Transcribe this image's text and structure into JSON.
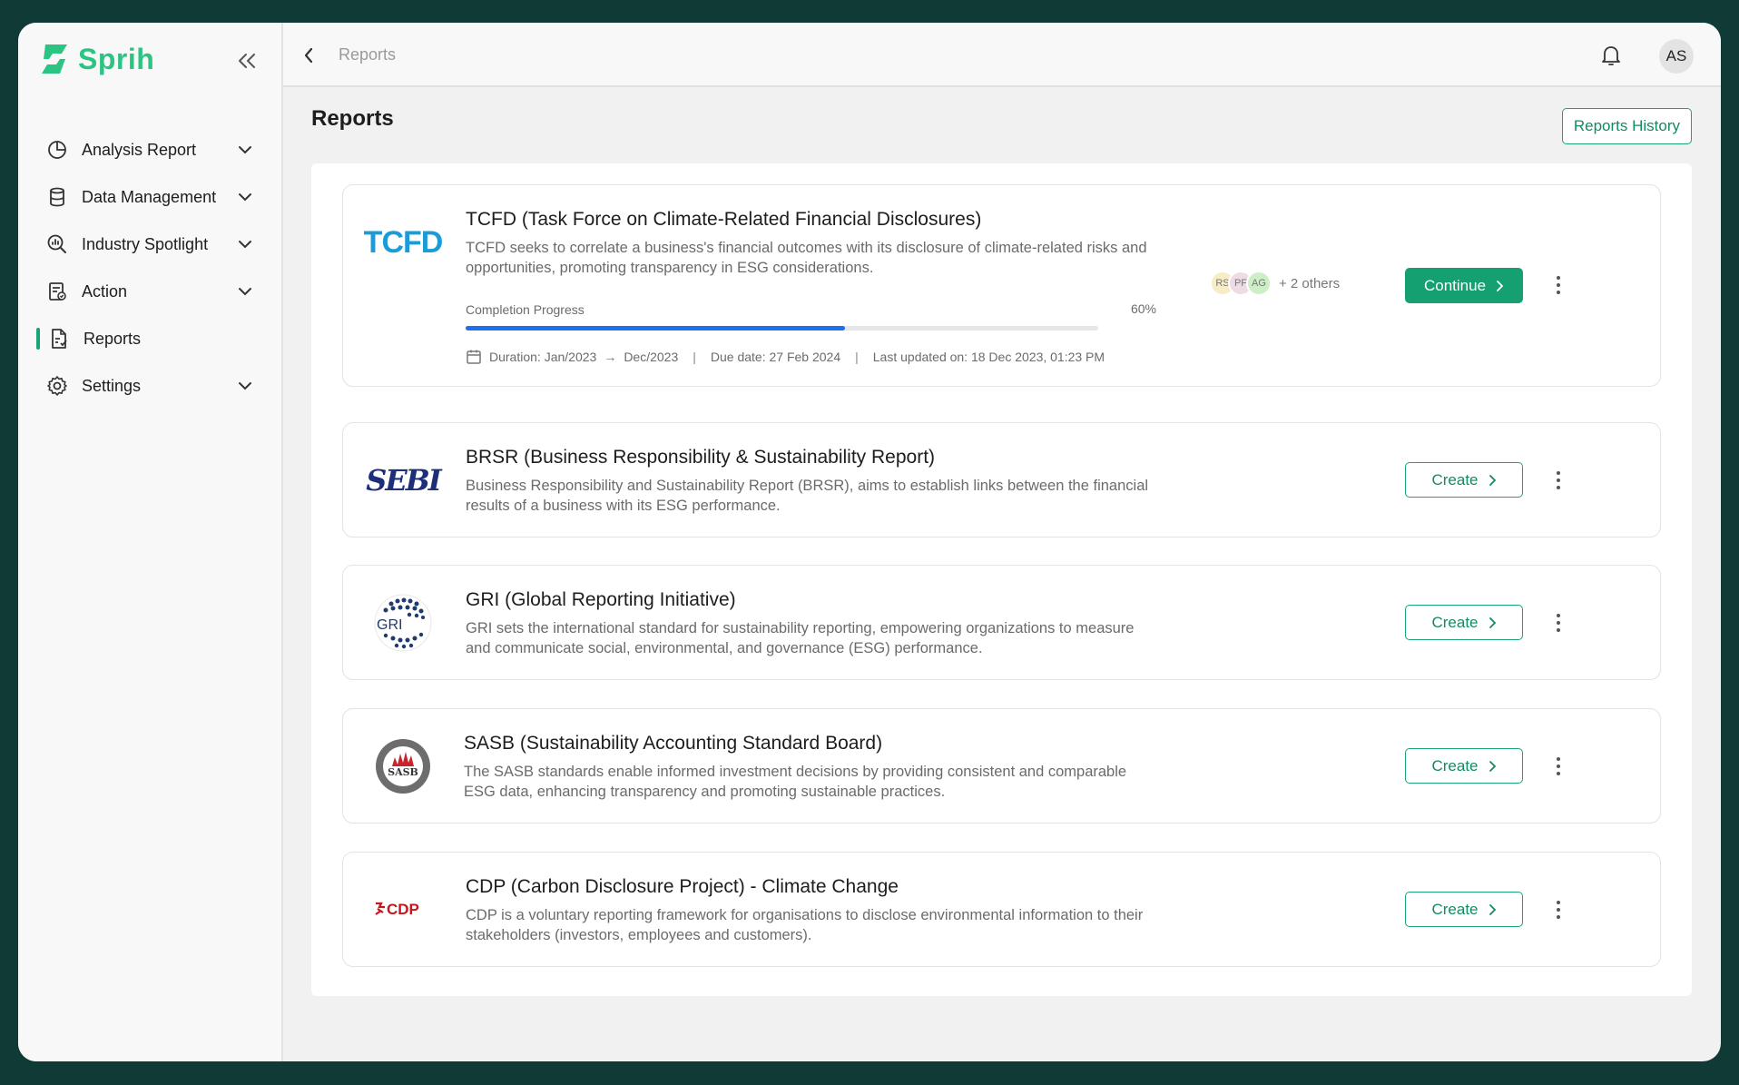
{
  "app": {
    "name": "Sprih",
    "brand_color": "#2cc483",
    "accent_color": "#15a072"
  },
  "sidebar": {
    "items": [
      {
        "label": "Analysis Report",
        "icon": "pie-chart-icon",
        "expandable": true
      },
      {
        "label": "Data Management",
        "icon": "database-icon",
        "expandable": true
      },
      {
        "label": "Industry Spotlight",
        "icon": "analytics-search-icon",
        "expandable": true
      },
      {
        "label": "Action",
        "icon": "checklist-icon",
        "expandable": true
      },
      {
        "label": "Reports",
        "icon": "report-file-icon",
        "expandable": false,
        "active": true
      },
      {
        "label": "Settings",
        "icon": "gear-icon",
        "expandable": true
      }
    ]
  },
  "topbar": {
    "breadcrumb": "Reports",
    "avatar_initials": "AS"
  },
  "page": {
    "title": "Reports",
    "history_button": "Reports History"
  },
  "reports": [
    {
      "logo_text": "TCFD",
      "title": "TCFD (Task Force on Climate-Related Financial Disclosures)",
      "description": "TCFD seeks to correlate a business's financial outcomes with its disclosure of climate-related risks and opportunities, promoting transparency in ESG considerations.",
      "progress_label": "Completion Progress",
      "progress_value": 60,
      "progress_text": "60%",
      "duration_label": "Duration: Jan/2023",
      "duration_end": "Dec/2023",
      "due_date": "Due date: 27 Feb 2024",
      "last_updated": "Last updated on: 18 Dec 2023, 01:23 PM",
      "collaborators": [
        "RS",
        "PF",
        "AG"
      ],
      "others": "+ 2 others",
      "action_label": "Continue"
    },
    {
      "logo_text": "SEBI",
      "title": "BRSR (Business Responsibility & Sustainability Report)",
      "description": "Business Responsibility and Sustainability Report (BRSR), aims to establish links between the financial results of a business with its ESG performance.",
      "action_label": "Create"
    },
    {
      "logo_text": "GRI",
      "title": "GRI (Global Reporting Initiative)",
      "description": "GRI sets the international standard for sustainability reporting, empowering organizations to measure and communicate social, environmental, and governance (ESG) performance.",
      "action_label": "Create"
    },
    {
      "logo_text": "SASB",
      "title": "SASB (Sustainability Accounting Standard Board)",
      "description": "The SASB standards enable informed investment decisions by providing consistent and comparable ESG data, enhancing transparency and promoting sustainable practices.",
      "action_label": "Create"
    },
    {
      "logo_text": "CDP",
      "title": "CDP (Carbon Disclosure Project) - Climate Change",
      "description": "CDP is a voluntary reporting framework for organisations to disclose environmental information to their stakeholders (investors, employees and customers).",
      "action_label": "Create"
    }
  ]
}
